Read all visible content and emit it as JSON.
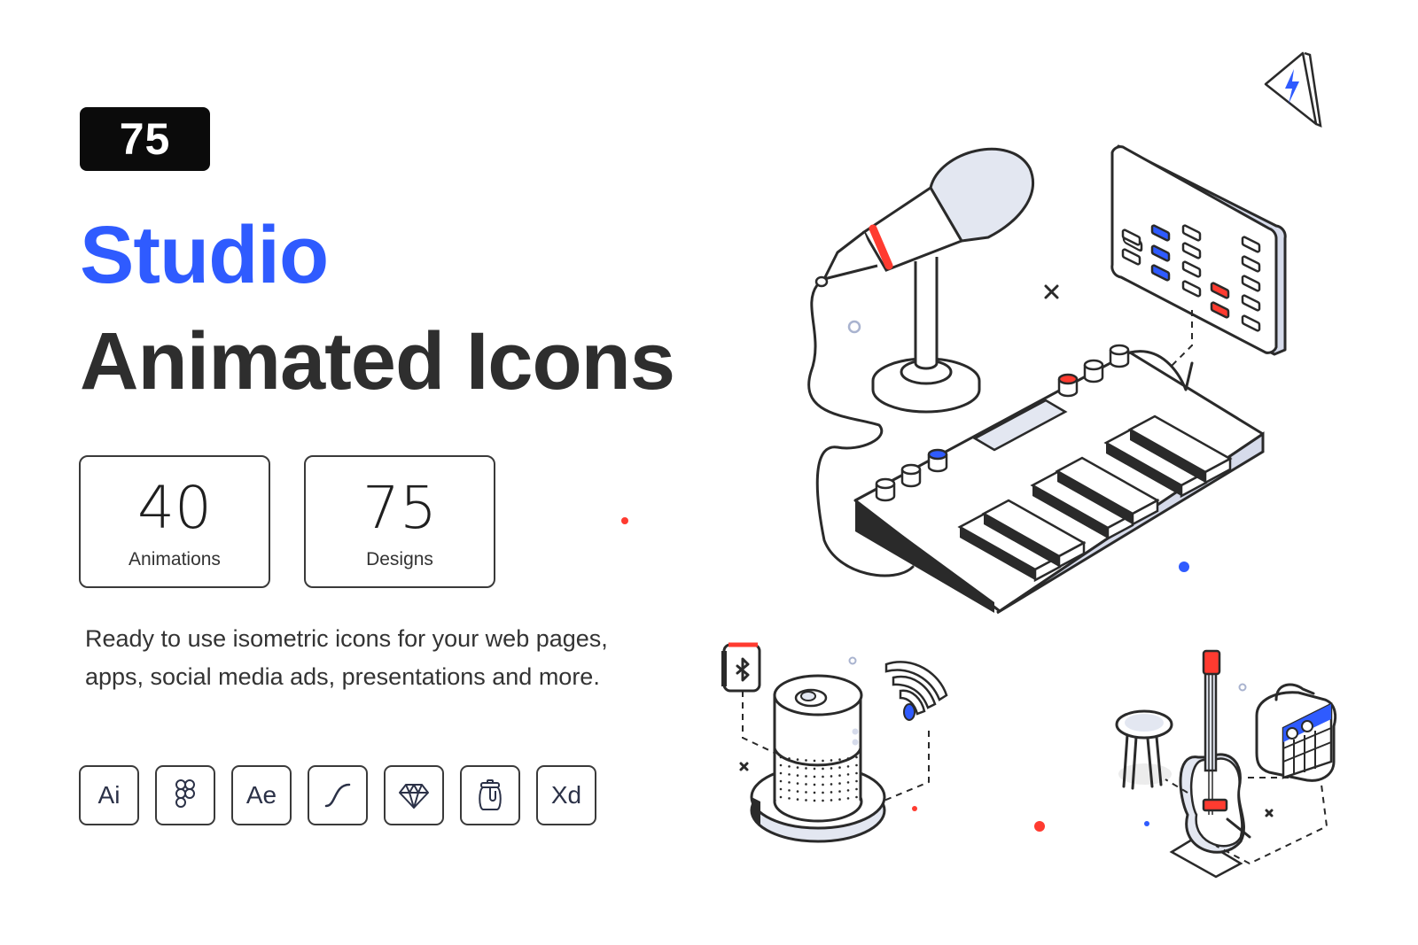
{
  "badge": {
    "count": "75"
  },
  "title": {
    "line1": "Studio",
    "line2": "Animated Icons"
  },
  "stats": [
    {
      "value": "40",
      "label": "Animations"
    },
    {
      "value": "75",
      "label": "Designs"
    }
  ],
  "description": "Ready to use isometric icons for your web pages, apps, social media ads, presentations and more.",
  "tools": [
    {
      "label": "Ai",
      "icon": "illustrator-icon"
    },
    {
      "label": "",
      "icon": "figma-icon"
    },
    {
      "label": "Ae",
      "icon": "after-effects-icon"
    },
    {
      "label": "",
      "icon": "bezier-curve-icon"
    },
    {
      "label": "",
      "icon": "sketch-diamond-icon"
    },
    {
      "label": "",
      "icon": "lottie-jar-icon"
    },
    {
      "label": "Xd",
      "icon": "xd-icon"
    }
  ],
  "colors": {
    "accent_blue": "#2f5bff",
    "accent_red": "#ff3b30",
    "dark": "#2e2e2e",
    "fill_light": "#e3e7f1"
  },
  "illustrations": [
    "microphone",
    "mixer-panel",
    "keyboard-synth",
    "smart-speaker",
    "bluetooth-badge",
    "wifi-signal",
    "stool",
    "guitar",
    "amplifier",
    "lightning-triangle"
  ]
}
